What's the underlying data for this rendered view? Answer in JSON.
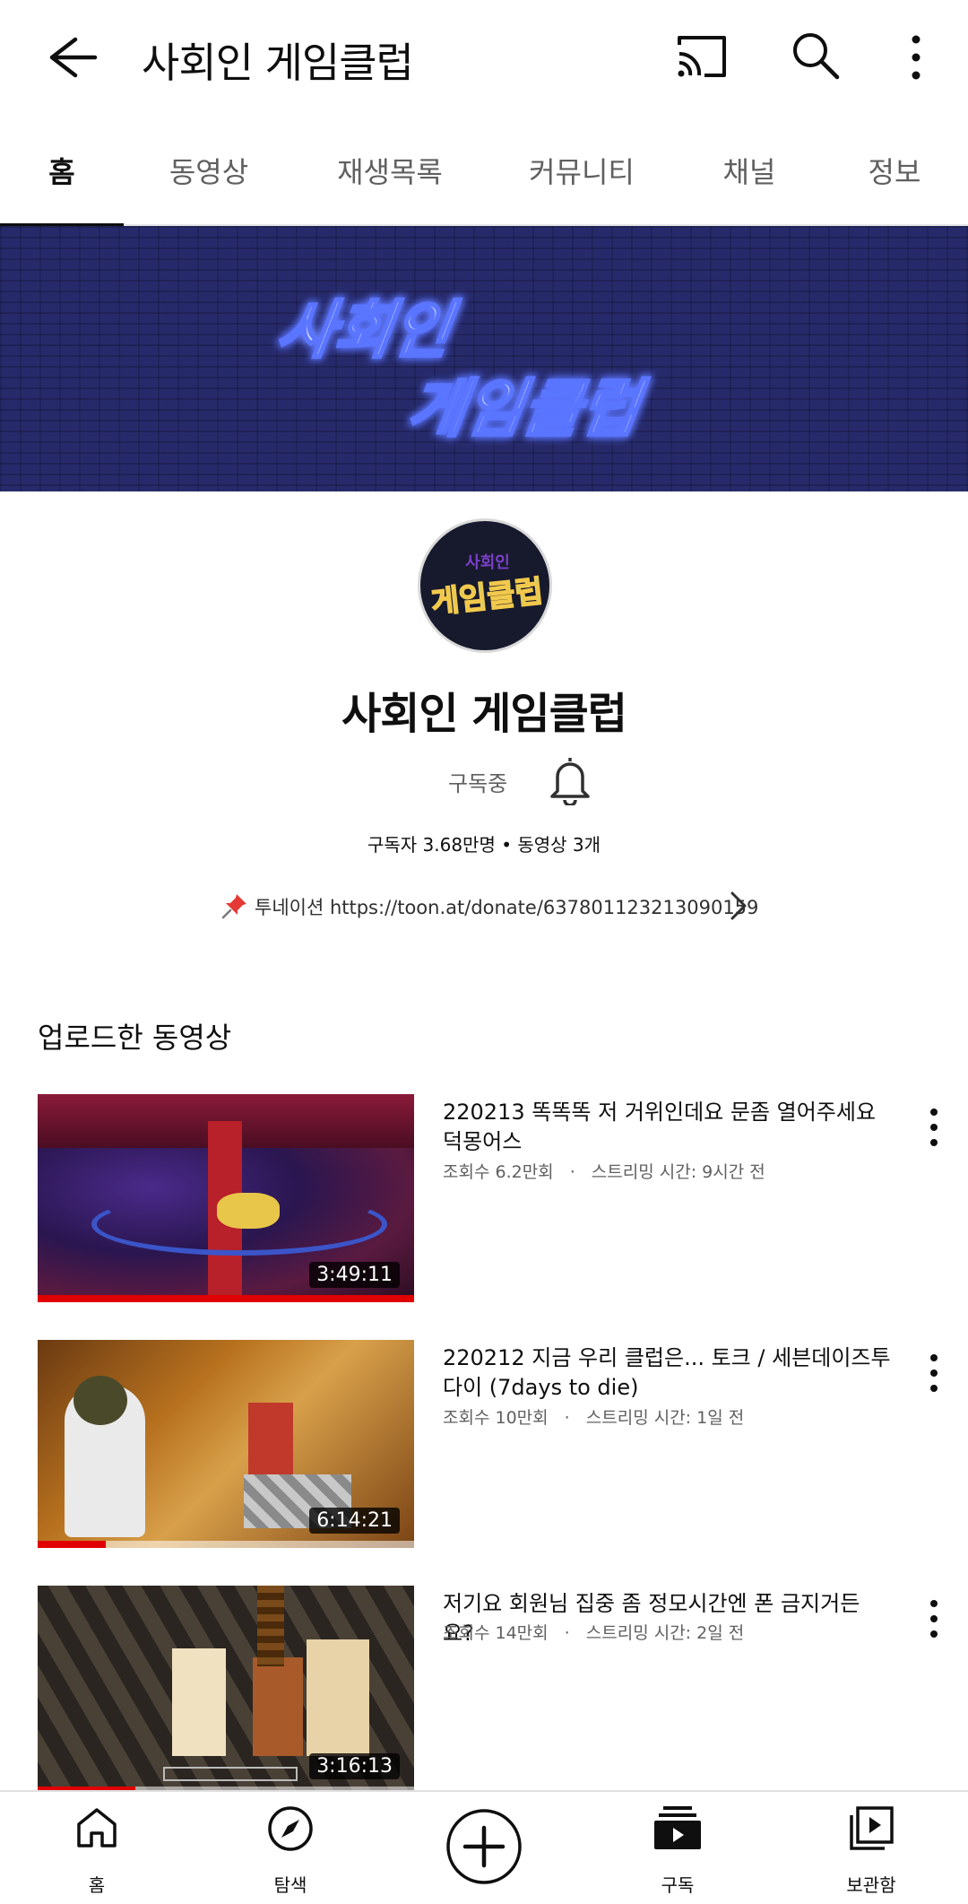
{
  "appbar": {
    "title": "사회인 게임클럽",
    "icons": [
      "back-arrow-icon",
      "cast-icon",
      "search-icon",
      "more-vert-icon"
    ]
  },
  "tabs": [
    {
      "label": "홈",
      "active": true
    },
    {
      "label": "동영상",
      "active": false
    },
    {
      "label": "재생목록",
      "active": false
    },
    {
      "label": "커뮤니티",
      "active": false
    },
    {
      "label": "채널",
      "active": false
    },
    {
      "label": "정보",
      "active": false
    }
  ],
  "banner": {
    "line1": "사회인",
    "line2": "게임클럽",
    "colors": {
      "background": "#272a6a",
      "text": "#9aa8ff",
      "glow": "#4f6bff"
    }
  },
  "avatar": {
    "small_text": "사회인",
    "big_text": "게임클럽"
  },
  "channel": {
    "name": "사회인 게임클럽",
    "subscribe_label": "구독중",
    "stats": "구독자 3.68만명 • 동영상 3개",
    "link_text": "투네이션 https://toon.at/donate/637801123213090159"
  },
  "section": {
    "title": "업로드한 동영상"
  },
  "videos": [
    {
      "title": "220213 똑똑똑 저 거위인데요 문좀 열어주세요 덕몽어스",
      "views": "조회수 6.2만회",
      "streamed": "스트리밍 시간: 9시간 전",
      "duration": "3:49:11",
      "watched": 1.0
    },
    {
      "title": "220212 지금 우리 클럽은... 토크 / 세븐데이즈투다이 (7days to die)",
      "views": "조회수 10만회",
      "streamed": "스트리밍 시간: 1일 전",
      "duration": "6:14:21",
      "watched": 0.18
    },
    {
      "title": "저기요 회원님 집중 좀 정모시간엔 폰 금지거든요?",
      "views": "조회수 14만회",
      "streamed": "스트리밍 시간: 2일 전",
      "duration": "3:16:13",
      "watched": 0.26
    }
  ],
  "bottomnav": [
    {
      "label": "홈",
      "icon": "home-icon"
    },
    {
      "label": "탐색",
      "icon": "explore-compass-icon"
    },
    {
      "label": "",
      "icon": "create-plus-icon"
    },
    {
      "label": "구독",
      "icon": "subscriptions-icon"
    },
    {
      "label": "보관함",
      "icon": "library-icon"
    }
  ],
  "separator": "·"
}
